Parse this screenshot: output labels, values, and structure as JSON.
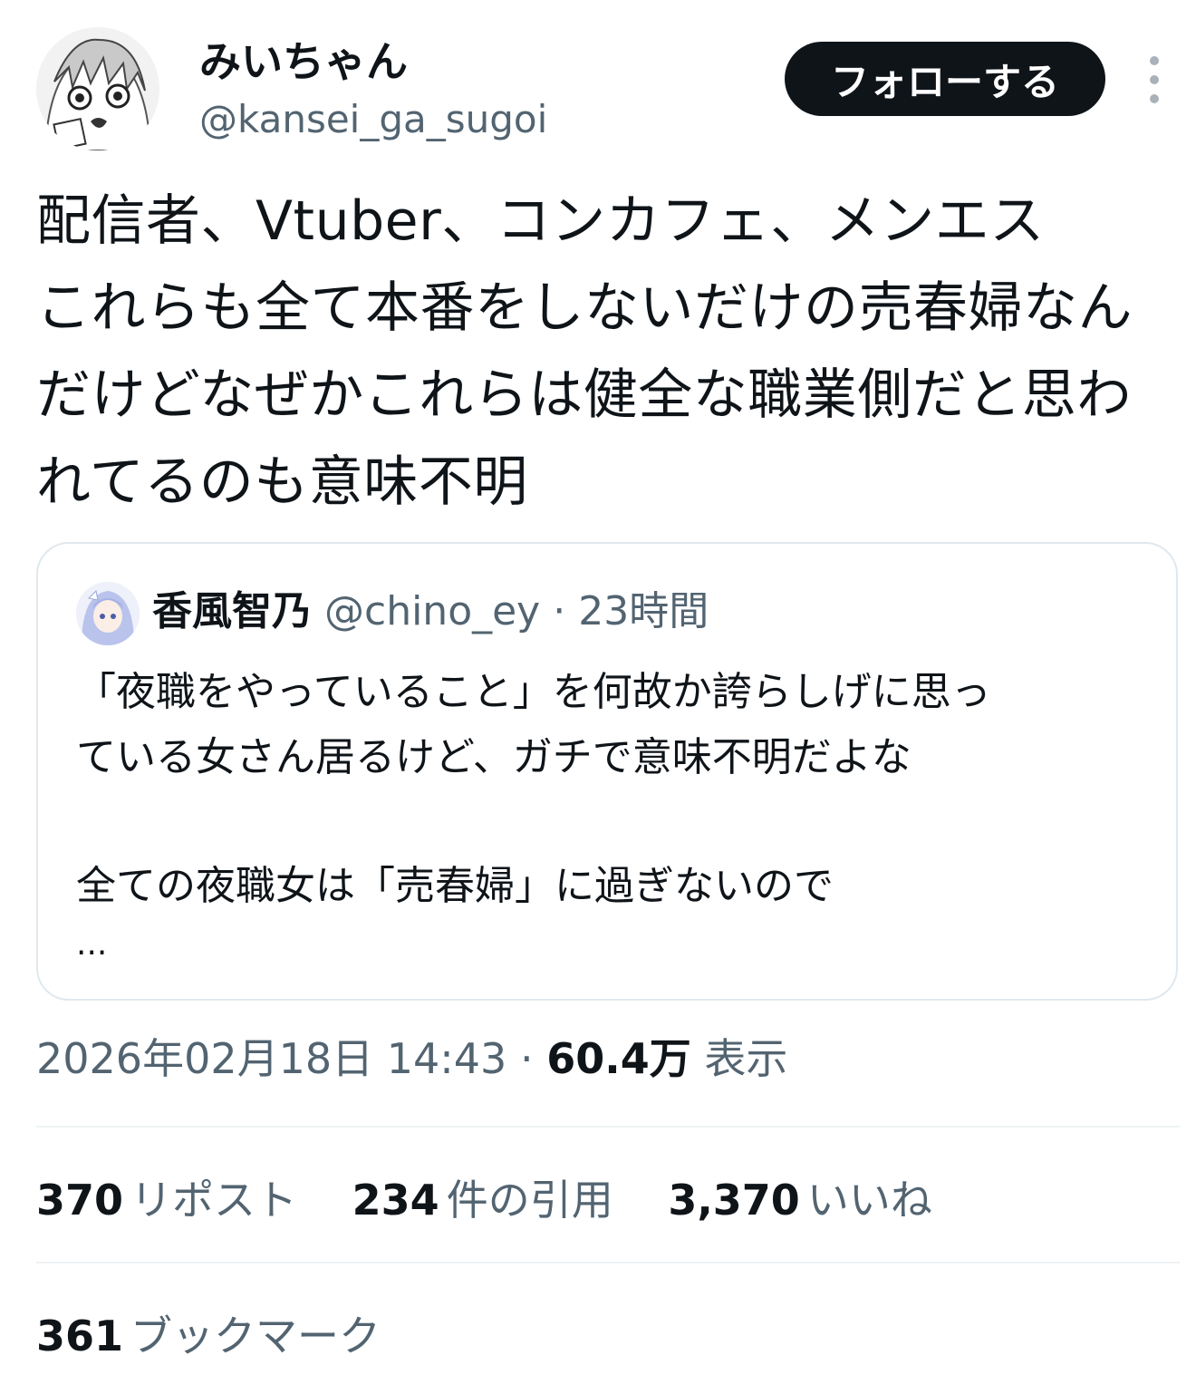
{
  "author": {
    "display_name": "みいちゃん",
    "handle": "@kansei_ga_sugoi"
  },
  "follow_button": "フォローする",
  "tweet": {
    "lines": [
      "配信者、Vtuber、コンカフェ、メンエス",
      "これらも全て本番をしないだけの売春婦なん",
      "だけどなぜかこれらは健全な職業側だと思わ",
      "れてるのも意味不明"
    ]
  },
  "quote": {
    "name": "香風智乃",
    "handle": "@chino_ey",
    "separator": "·",
    "time": "23時間",
    "lines": [
      "「夜職をやっていること」を何故か誇らしげに思っ",
      "ている女さん居るけど、ガチで意味不明だよな"
    ],
    "line3": "全ての夜職女は「売春婦」に過ぎないので",
    "ellipsis": "..."
  },
  "meta": {
    "datetime": "2026年02月18日 14:43",
    "separator": "·",
    "views_count": "60.4万",
    "views_label": "表示"
  },
  "stats": {
    "reposts_count": "370",
    "reposts_label": "リポスト",
    "quotes_count": "234",
    "quotes_label": "件の引用",
    "likes_count": "3,370",
    "likes_label": "いいね",
    "bookmarks_count": "361",
    "bookmarks_label": "ブックマーク"
  },
  "colors": {
    "text_primary": "#0f1419",
    "text_secondary": "#536471",
    "follow_bg": "#0f1419",
    "border": "#e1e8ed"
  },
  "icons": [
    "more-vertical-icon"
  ]
}
